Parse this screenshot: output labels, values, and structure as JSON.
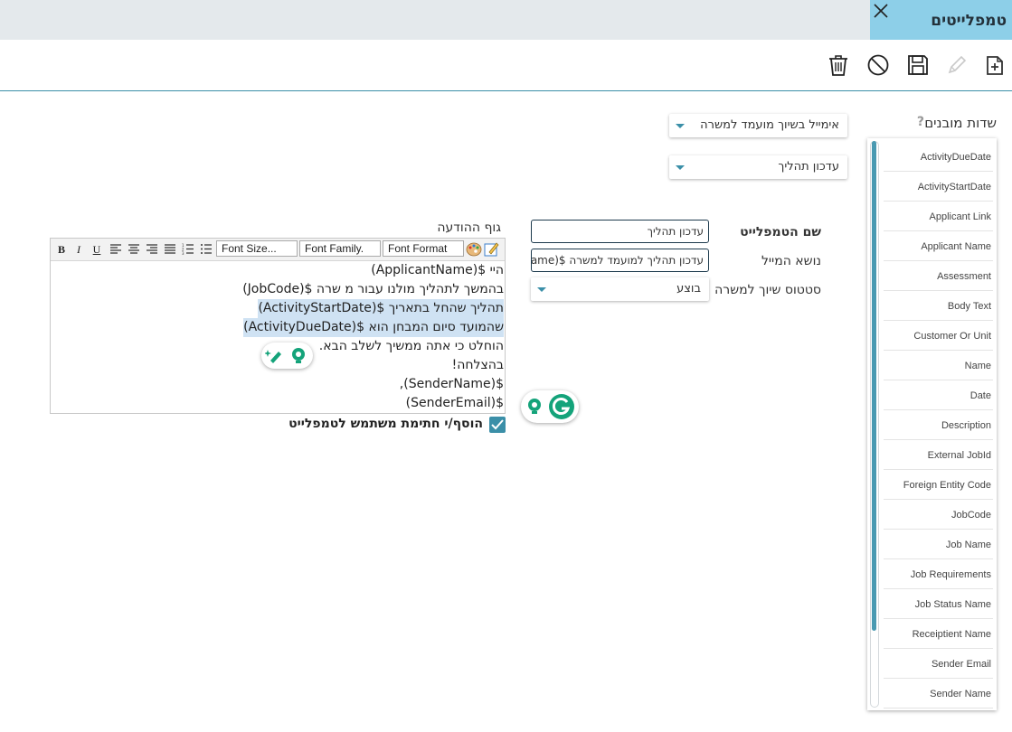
{
  "header": {
    "title": "טמפלייטים",
    "close_icon": "close-icon"
  },
  "toolbar": {
    "icons": [
      "new-template-icon",
      "edit-icon",
      "save-icon",
      "cancel-icon",
      "delete-icon"
    ]
  },
  "sidebar": {
    "title": "שדות מובנים",
    "help_mark": "?",
    "fields": [
      "ActivityDueDate",
      "ActivityStartDate",
      "Applicant Link",
      "Applicant Name",
      "Assessment",
      "Body Text",
      "Customer Or Unit",
      "Name",
      "Date",
      "Description",
      "External JobId",
      "Foreign Entity Code",
      "JobCode",
      "Job Name",
      "Job Requirements",
      "Job Status Name",
      "Receiptient Name",
      "Sender Email",
      "Sender Name"
    ]
  },
  "filters": {
    "category_value": "אימייל בשיוך מועמד למשרה",
    "template_value": "עדכון תהליך"
  },
  "form": {
    "name_label": "שם הטמפלייט",
    "name_value": "עדכון תהליך",
    "subject_label": "נושא המייל",
    "subject_value": "עדכון תהליך למועמד למשרה $(ame",
    "status_label": "סטטוס שיוך למשרה",
    "status_value": "בוצע"
  },
  "editor": {
    "label": "גוף ההודעה",
    "font_format": "Font Format",
    "font_family": "Font Family.",
    "font_size": "Font Size...",
    "bold": "B",
    "italic": "I",
    "underline": "U",
    "lines": [
      "היי $(ApplicantName)",
      "בהמשך לתהליך מולנו עבור מ שרה $(JobCode)",
      "תהליך שהחל בתאריך $(ActivityStartDate)",
      "שהמועד סיום המבחן הוא $(ActivityDueDate)",
      "הוחלט כי אתה ממשיך לשלב הבא.",
      "בהצלחה!",
      "$(SenderName),",
      "$(SenderEmail)"
    ],
    "signature_checkbox_label": "הוסף/י חתימת משתמש לטמפלייט",
    "signature_checked": true
  },
  "colors": {
    "accent": "#3b8fa8",
    "header_tab": "#8dcfe8",
    "topbar": "#e4e9ec"
  }
}
